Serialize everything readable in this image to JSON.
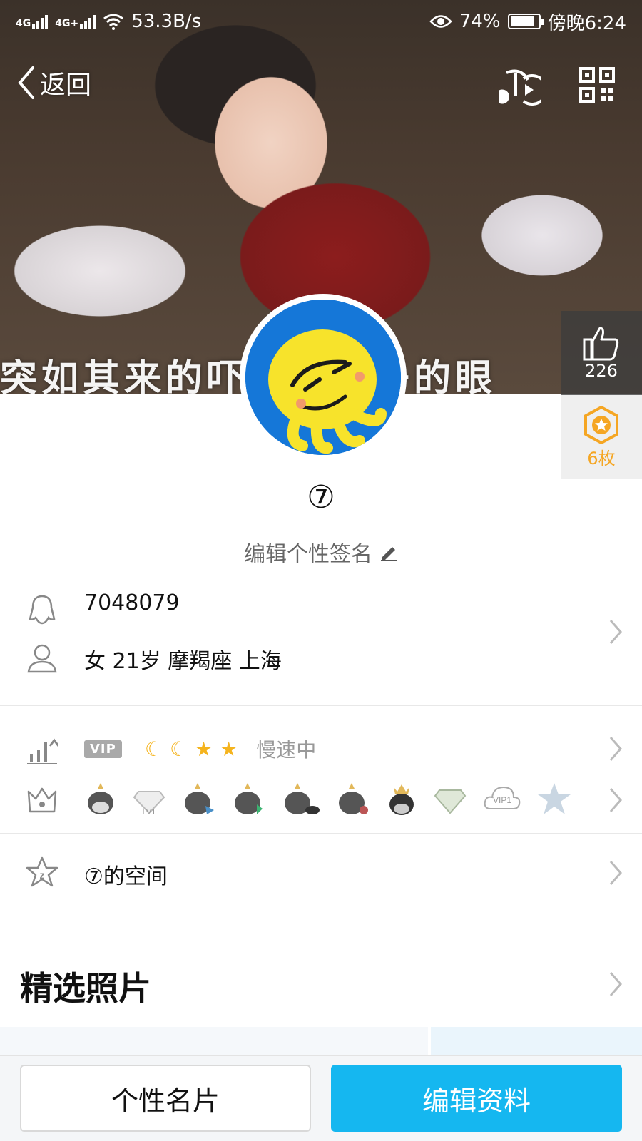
{
  "status_bar": {
    "network_1": "4G",
    "network_2": "4G+",
    "speed": "53.3B/s",
    "battery": "74%",
    "time": "傍晚6:24"
  },
  "nav": {
    "back_label": "返回"
  },
  "cover": {
    "caption": "突如其来的吓坏了老子的眼"
  },
  "side": {
    "like_count": "226",
    "badge_count": "6枚"
  },
  "profile": {
    "nickname": "⑦",
    "signature": "编辑个性签名"
  },
  "info": {
    "qq_number": "7048079",
    "details": "女  21岁  摩羯座  上海"
  },
  "level": {
    "vip_tag": "VIP",
    "status": "慢速中"
  },
  "medals": {
    "items": [
      "penguin",
      "LV1",
      "penguin",
      "penguin",
      "penguin",
      "penguin",
      "penguin",
      "diamond",
      "VIP1",
      "star"
    ]
  },
  "space": {
    "label": "⑦的空间"
  },
  "photos": {
    "title": "精选照片"
  },
  "bottom": {
    "card_button": "个性名片",
    "edit_button": "编辑资料"
  },
  "colors": {
    "accent": "#15b7f0",
    "gold": "#f5a623",
    "avatar_bg": "#1577d8"
  }
}
